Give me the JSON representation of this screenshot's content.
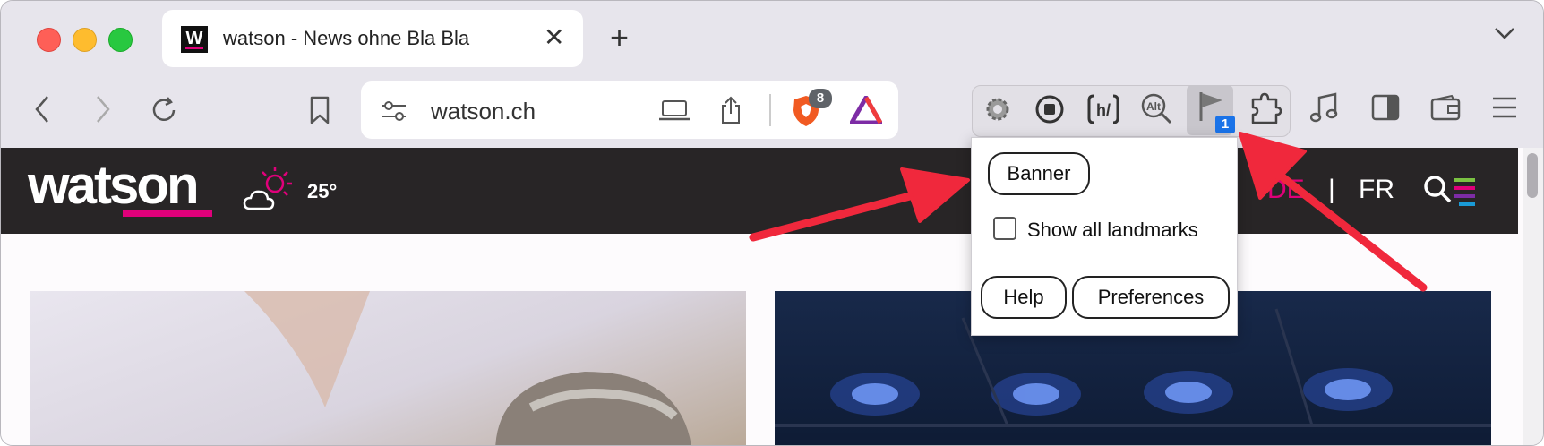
{
  "tab": {
    "title": "watson - News ohne Bla Bla",
    "favicon": "W"
  },
  "toolbar": {
    "url": "watson.ch",
    "brave_badge": "8",
    "landmarks_badge": "1"
  },
  "site": {
    "logo": "watson",
    "temperature": "25°",
    "lang_de": "DE",
    "lang_sep": "|",
    "lang_fr": "FR"
  },
  "popup": {
    "banner_label": "Banner",
    "show_all_label": "Show all landmarks",
    "help_label": "Help",
    "preferences_label": "Preferences"
  },
  "colors": {
    "accent": "#e0007a",
    "arrow": "#f0283c",
    "header_bg": "#282526"
  }
}
